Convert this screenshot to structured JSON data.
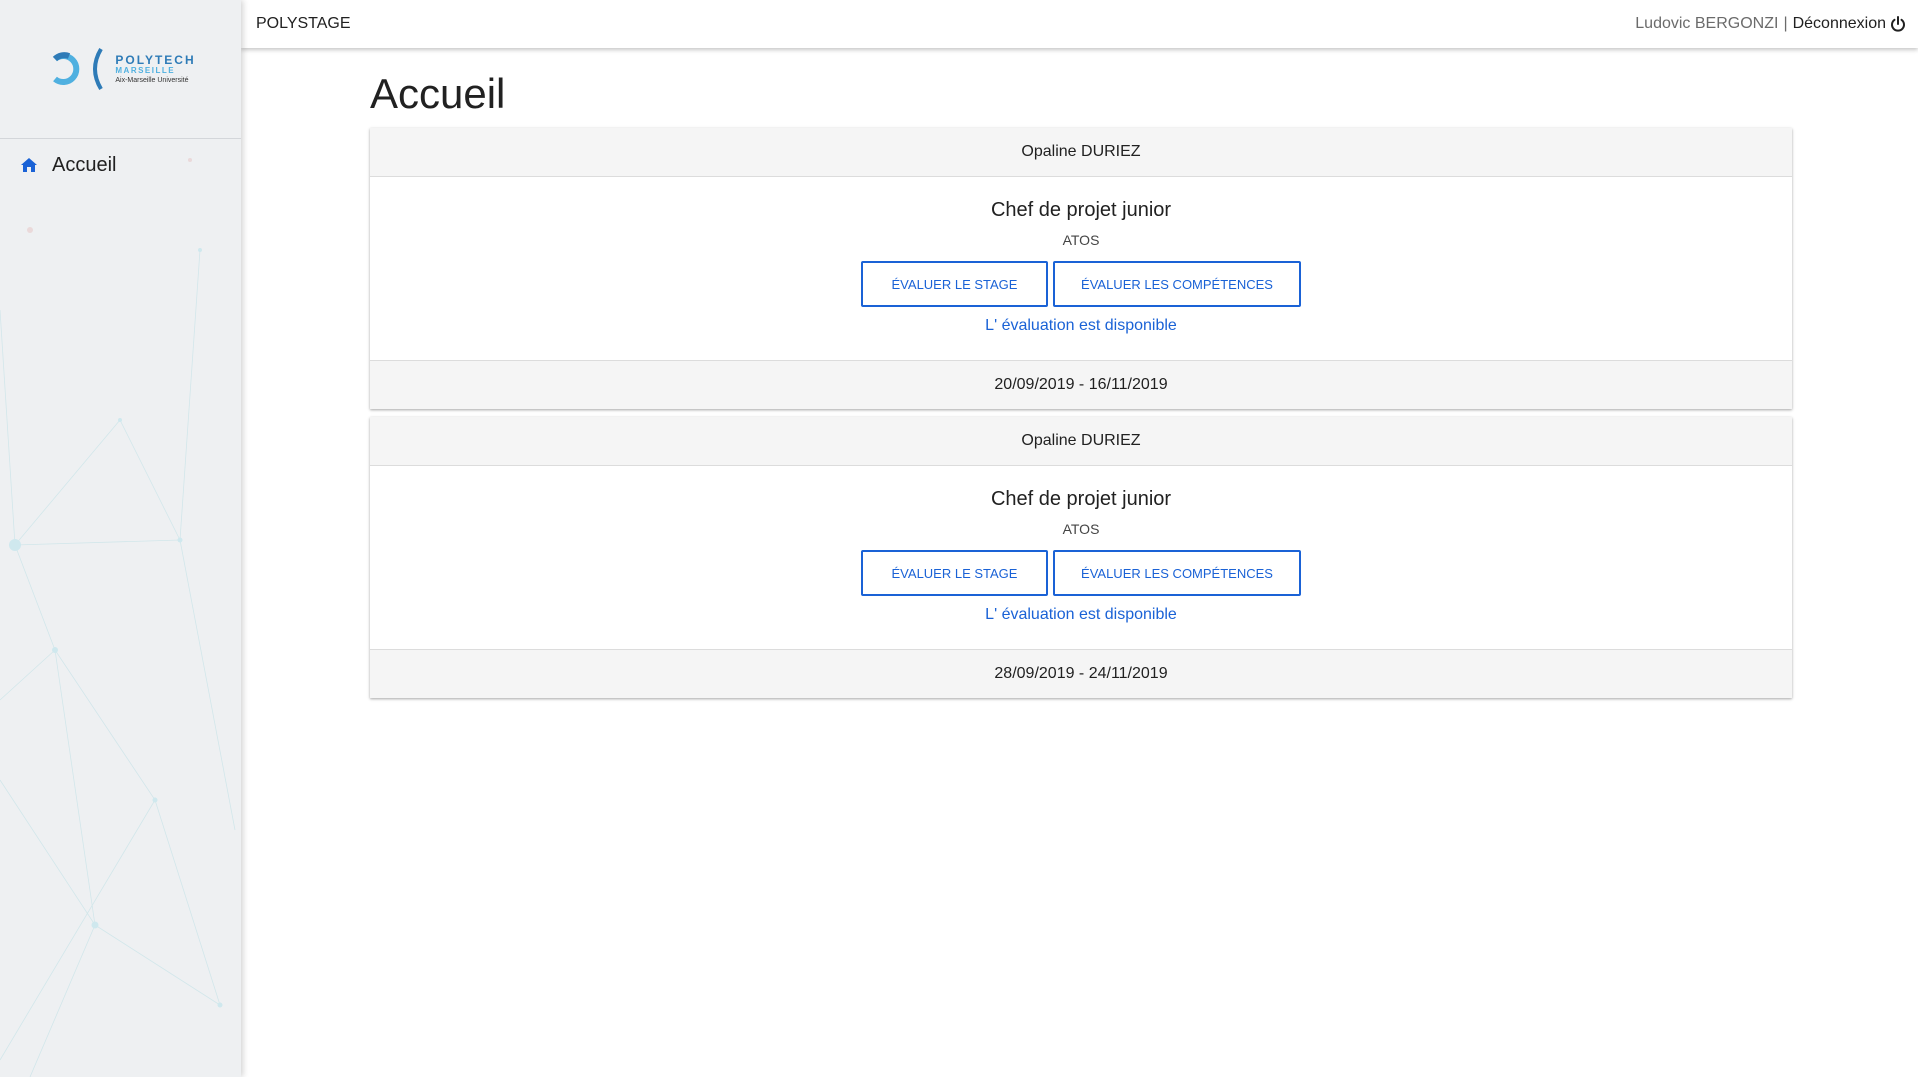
{
  "app": {
    "name": "POLYSTAGE"
  },
  "user": {
    "name": "Ludovic BERGONZI",
    "separator": "|",
    "logout_label": "Déconnexion"
  },
  "logo": {
    "line1": "POLYTECH",
    "line2": "MARSEILLE",
    "line3": "Aix-Marseille Université"
  },
  "sidebar": {
    "items": [
      {
        "label": "Accueil",
        "icon": "home-icon"
      }
    ]
  },
  "page": {
    "title": "Accueil"
  },
  "cards": [
    {
      "student": "Opaline DURIEZ",
      "job_title": "Chef de projet junior",
      "company": "ATOS",
      "evaluate_internship_label": "ÉVALUER LE STAGE",
      "evaluate_skills_label": "ÉVALUER LES COMPÉTENCES",
      "status_link": "L' évaluation est disponible",
      "dates": "20/09/2019 - 16/11/2019"
    },
    {
      "student": "Opaline DURIEZ",
      "job_title": "Chef de projet junior",
      "company": "ATOS",
      "evaluate_internship_label": "ÉVALUER LE STAGE",
      "evaluate_skills_label": "ÉVALUER LES COMPÉTENCES",
      "status_link": "L' évaluation est disponible",
      "dates": "28/09/2019 - 24/11/2019"
    }
  ],
  "colors": {
    "accent": "#1a62d6",
    "logo_blue": "#2e7bb7",
    "logo_light_blue": "#4fb0e0",
    "card_header_bg": "#f5f5f5"
  }
}
